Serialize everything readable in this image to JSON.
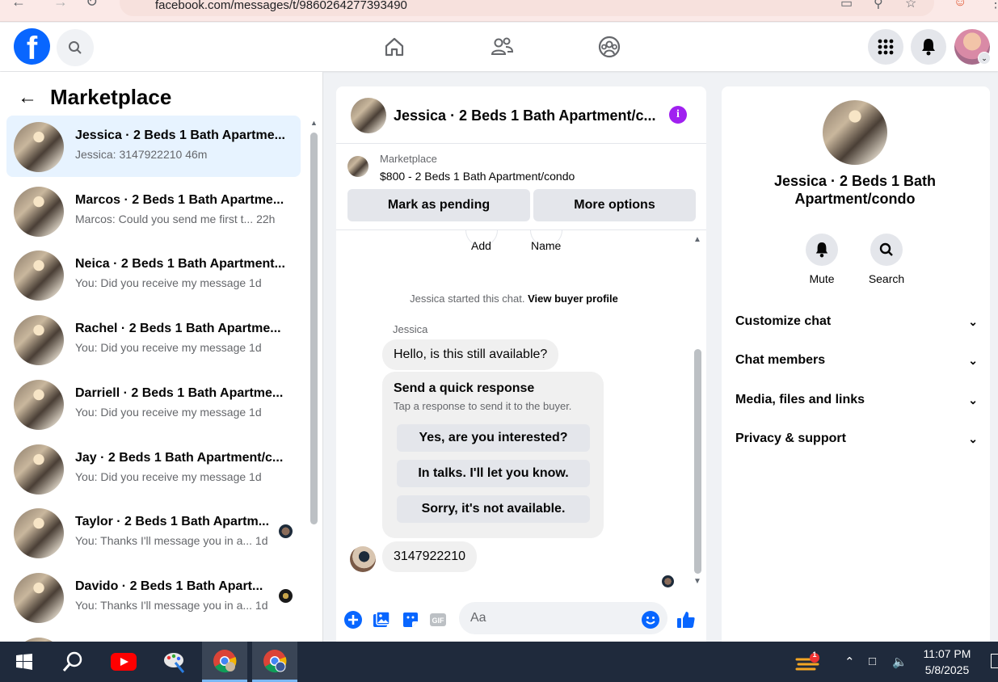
{
  "browser": {
    "url": "facebook.com/messages/t/9860264277393490"
  },
  "header": {
    "logo_letter": "f"
  },
  "marketplace": {
    "title": "Marketplace",
    "conversations": [
      {
        "name": "Jessica · 2 Beds 1 Bath Apartme...",
        "preview": "Jessica: 3147922210 46m",
        "active": true
      },
      {
        "name": "Marcos · 2 Beds 1 Bath Apartme...",
        "preview": "Marcos: Could you send me first t...  22h"
      },
      {
        "name": "Neica · 2 Beds 1 Bath Apartment...",
        "preview": "You: Did you receive my message 1d"
      },
      {
        "name": "Rachel · 2 Beds 1 Bath Apartme...",
        "preview": "You: Did you receive my message 1d"
      },
      {
        "name": "Darriell · 2 Beds 1 Bath Apartme...",
        "preview": "You: Did you receive my message 1d"
      },
      {
        "name": "Jay · 2 Beds 1 Bath Apartment/c...",
        "preview": "You: Did you receive my message 1d"
      },
      {
        "name": "Taylor · 2 Beds 1 Bath Apartm...",
        "preview": "You: Thanks I'll message you in a...  1d"
      },
      {
        "name": "Davido · 2 Beds 1 Bath Apart...",
        "preview": "You: Thanks I'll message you in a...  1d"
      }
    ]
  },
  "chat": {
    "title": "Jessica · 2 Beds 1 Bath Apartment/c...",
    "listing_label": "Marketplace",
    "listing_price": "$800 - 2 Beds 1 Bath Apartment/condo",
    "mark_pending": "Mark as pending",
    "more_options": "More options",
    "ghost_add": "Add",
    "ghost_name": "Name",
    "started_text": "Jessica started this chat.",
    "view_buyer_profile": "View buyer profile",
    "sender": "Jessica",
    "first_message": "Hello, is this still available?",
    "quick_title": "Send a quick response",
    "quick_subtitle": "Tap a response to send it to the buyer.",
    "quick_responses": [
      "Yes, are you interested?",
      "In talks. I'll let you know.",
      "Sorry, it's not available."
    ],
    "my_message": "3147922210",
    "composer_placeholder": "Aa"
  },
  "info": {
    "name": "Jessica · 2 Beds 1 Bath Apartment/condo",
    "mute": "Mute",
    "search": "Search",
    "sections": [
      "Customize chat",
      "Chat members",
      "Media, files and links",
      "Privacy & support"
    ]
  },
  "taskbar": {
    "time": "11:07 PM",
    "date": "5/8/2025",
    "notification_count": "1"
  },
  "colors": {
    "fb_blue": "#0866ff",
    "active_row": "#e7f3ff",
    "info_purple": "#a020f0",
    "taskbar": "#1f2a3c"
  }
}
